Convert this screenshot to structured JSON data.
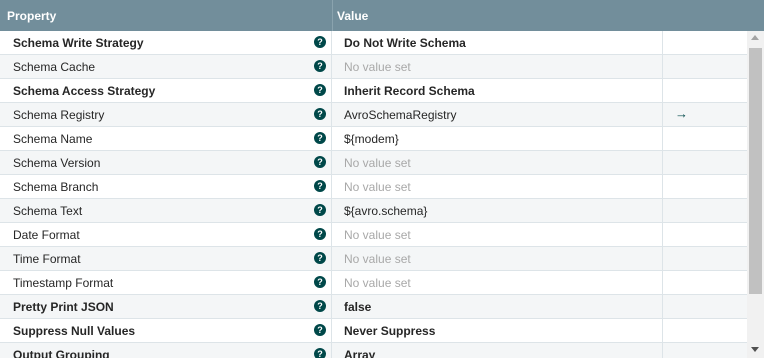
{
  "header": {
    "property_label": "Property",
    "value_label": "Value"
  },
  "help_glyph": "?",
  "goto_glyph": "→",
  "rows": [
    {
      "name": "Schema Write Strategy",
      "value": "Do Not Write Schema",
      "bold": true
    },
    {
      "name": "Schema Cache",
      "value": "No value set",
      "unset": true
    },
    {
      "name": "Schema Access Strategy",
      "value": "Inherit Record Schema",
      "bold": true
    },
    {
      "name": "Schema Registry",
      "value": "AvroSchemaRegistry",
      "goto": true
    },
    {
      "name": "Schema Name",
      "value": "${modem}"
    },
    {
      "name": "Schema Version",
      "value": "No value set",
      "unset": true
    },
    {
      "name": "Schema Branch",
      "value": "No value set",
      "unset": true
    },
    {
      "name": "Schema Text",
      "value": "${avro.schema}"
    },
    {
      "name": "Date Format",
      "value": "No value set",
      "unset": true
    },
    {
      "name": "Time Format",
      "value": "No value set",
      "unset": true
    },
    {
      "name": "Timestamp Format",
      "value": "No value set",
      "unset": true
    },
    {
      "name": "Pretty Print JSON",
      "value": "false",
      "bold": true
    },
    {
      "name": "Suppress Null Values",
      "value": "Never Suppress",
      "bold": true
    },
    {
      "name": "Output Grouping",
      "value": "Array",
      "bold": true
    }
  ],
  "colors": {
    "header_bg": "#728e9b",
    "help_icon": "#004849",
    "unset_text": "#a8a8a8"
  }
}
